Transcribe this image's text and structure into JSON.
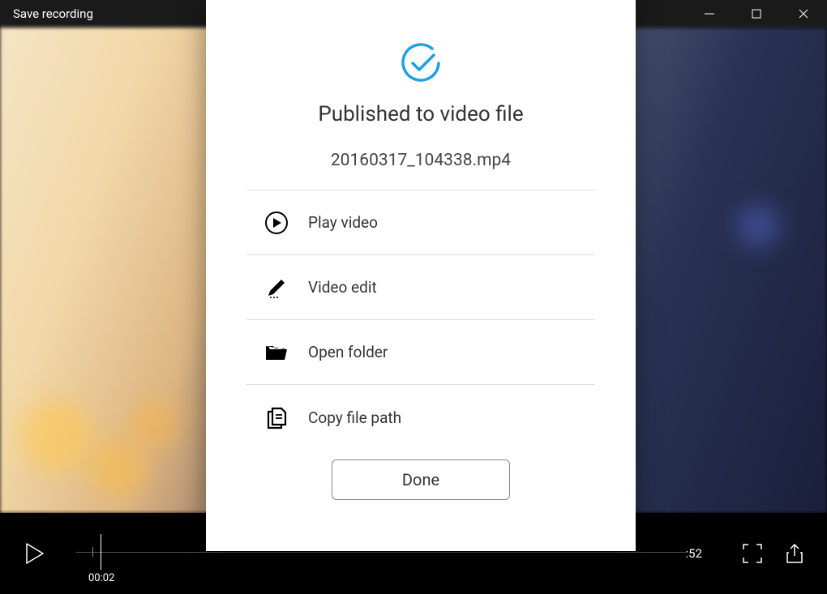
{
  "titlebar": {
    "title": "Save recording"
  },
  "player": {
    "current_time": "00:02",
    "end_time": ":52"
  },
  "dialog": {
    "title": "Published to video file",
    "filename": "20160317_104338.mp4",
    "options": {
      "play": "Play video",
      "edit": "Video edit",
      "folder": "Open folder",
      "copy": "Copy file path"
    },
    "done_label": "Done"
  }
}
